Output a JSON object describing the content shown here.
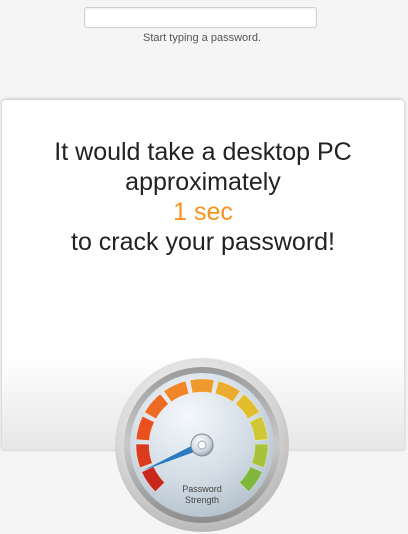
{
  "input": {
    "value": "",
    "placeholder": ""
  },
  "hint": "Start typing a password.",
  "result": {
    "line1": "It would take a desktop PC",
    "line2": "approximately",
    "time": "1 sec",
    "line3": "to crack your password!"
  },
  "gauge": {
    "label_line1": "Password",
    "label_line2": "Strength",
    "strength_fraction": 0.08,
    "segment_colors": [
      "#c8281c",
      "#dc3a1c",
      "#e8501f",
      "#ec6a22",
      "#f0852a",
      "#f09a2e",
      "#ecac2f",
      "#e2bd2e",
      "#cfc733",
      "#a8c23a",
      "#7fb83c"
    ]
  },
  "colors": {
    "accent": "#f7931e",
    "needle": "#2b7bc0"
  }
}
